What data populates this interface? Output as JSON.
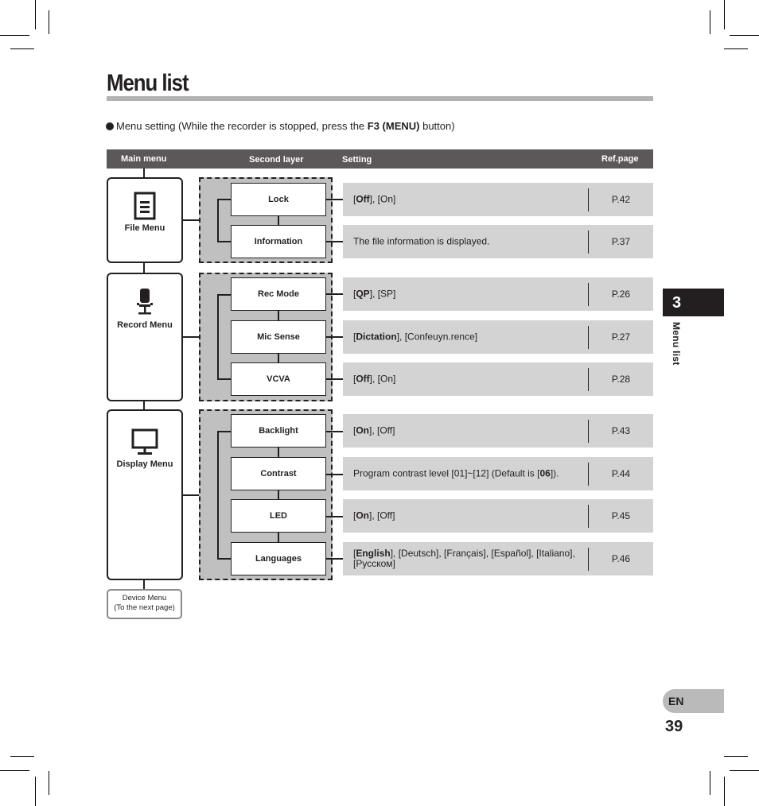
{
  "page": {
    "title": "Menu list",
    "intro_prefix": "Menu setting (While the recorder is stopped, press the ",
    "intro_bold": "F3 (MENU)",
    "intro_suffix": " button)"
  },
  "table_header": {
    "main_menu": "Main menu",
    "second_layer": "Second layer",
    "setting": "Setting",
    "ref_page": "Ref.page"
  },
  "main_menus": [
    {
      "label": "File Menu",
      "icon": "document-icon",
      "items": [
        {
          "label": "Lock",
          "setting_bold": "Off",
          "setting_pre": "[",
          "setting_post": "], [On]",
          "ref": "P.42"
        },
        {
          "label": "Information",
          "setting_bold": "",
          "setting_pre": "The file information is displayed.",
          "setting_post": "",
          "ref": "P.37"
        }
      ]
    },
    {
      "label": "Record Menu",
      "icon": "microphone-icon",
      "items": [
        {
          "label": "Rec Mode",
          "setting_bold": "QP",
          "setting_pre": "[",
          "setting_post": "], [SP]",
          "ref": "P.26"
        },
        {
          "label": "Mic Sense",
          "setting_bold": "Dictation",
          "setting_pre": "[",
          "setting_post": "], [Confeuyn.rence]",
          "ref": "P.27"
        },
        {
          "label": "VCVA",
          "setting_bold": "Off",
          "setting_pre": "[",
          "setting_post": "], [On]",
          "ref": "P.28"
        }
      ]
    },
    {
      "label": "Display Menu",
      "icon": "monitor-icon",
      "items": [
        {
          "label": "Backlight",
          "setting_bold": "On",
          "setting_pre": "[",
          "setting_post": "], [Off]",
          "ref": "P.43"
        },
        {
          "label": "Contrast",
          "setting_bold": "06",
          "setting_pre": "Program contrast level [01]~[12] (Default is [",
          "setting_post": "]).",
          "ref": "P.44"
        },
        {
          "label": "LED",
          "setting_bold": "On",
          "setting_pre": "[",
          "setting_post": "], [Off]",
          "ref": "P.45"
        },
        {
          "label": "Languages",
          "setting_bold": "English",
          "setting_pre": "[",
          "setting_post": "], [Deutsch], [Français], [Español], [Italiano], [Русском]",
          "ref": "P.46"
        }
      ]
    }
  ],
  "device_menu": {
    "line1": "Device Menu",
    "line2": "(To the next page)"
  },
  "side": {
    "chapter_number": "3",
    "chapter_label": "Menu list",
    "language": "EN",
    "page_number": "39"
  },
  "colors": {
    "header_bg": "#5b5859",
    "group_bg": "#c0c0c0",
    "setting_bg": "#d3d3d3",
    "chapter_tab": "#231f20",
    "lang_tab": "#bababa"
  }
}
